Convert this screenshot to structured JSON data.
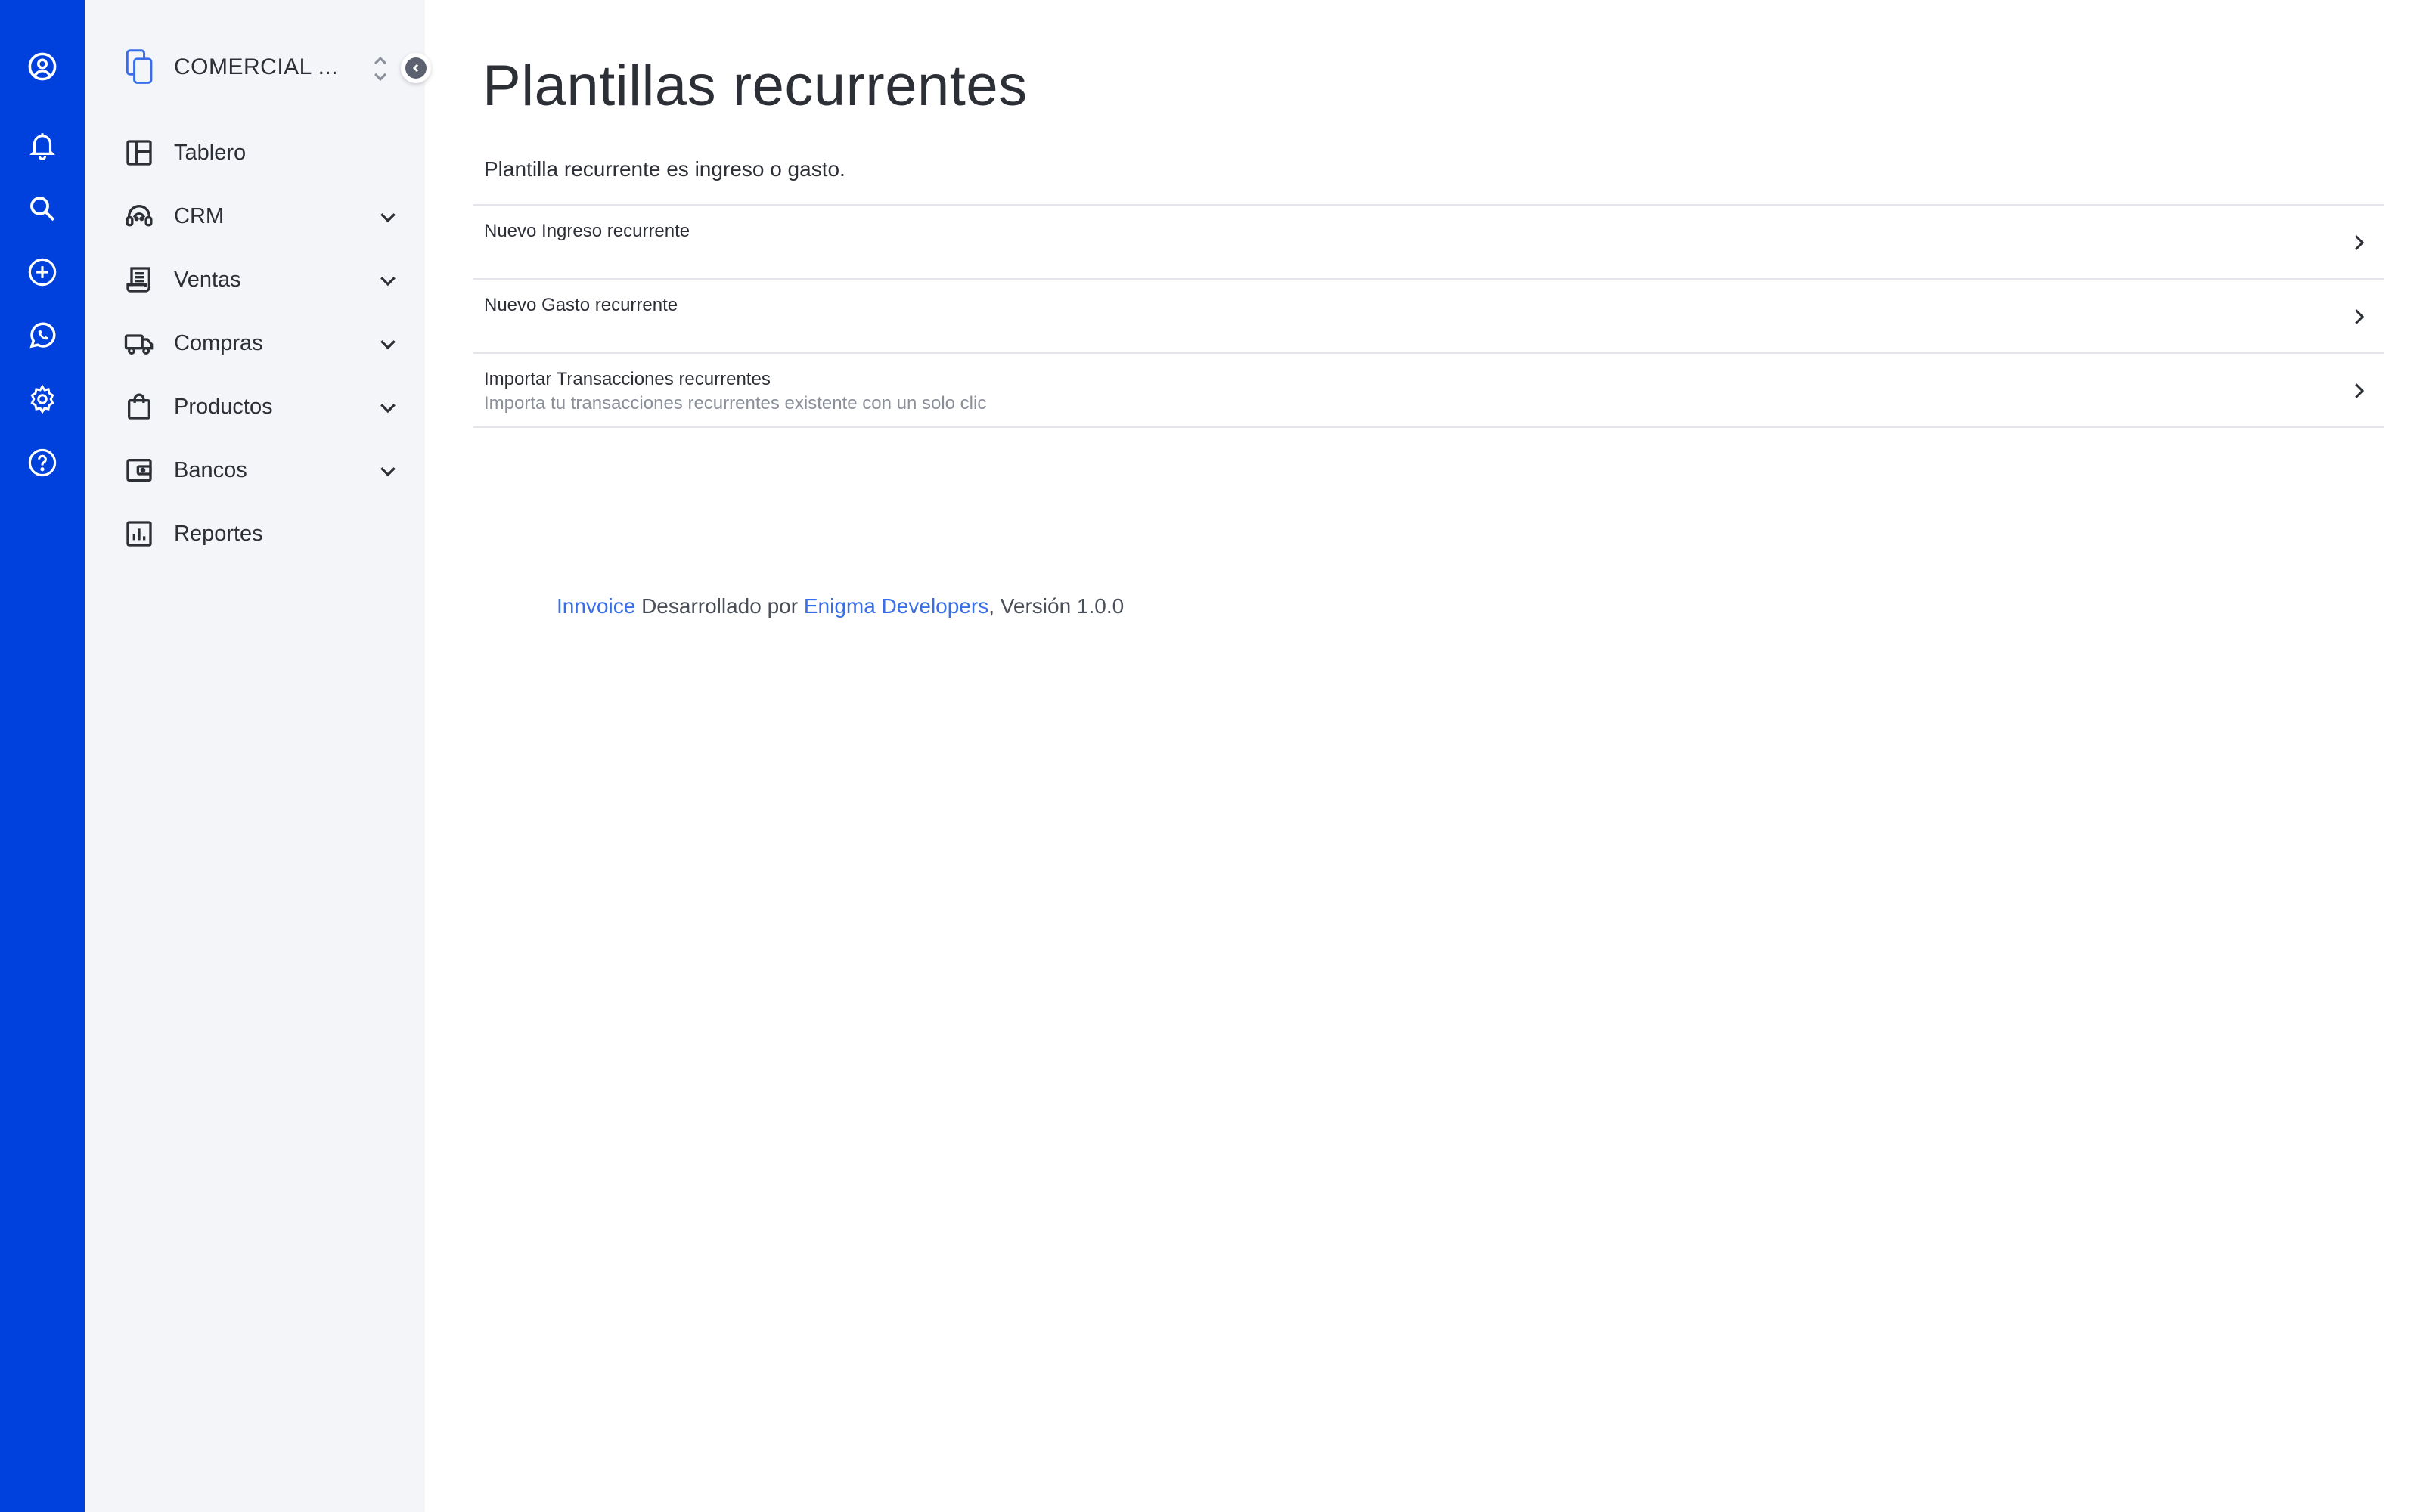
{
  "colors": {
    "rail": "#0040dd",
    "sidebar": "#f3f5f9",
    "link": "#3a6ee8",
    "text": "#2d2f36",
    "muted": "#8a8f99"
  },
  "rail": {
    "items": [
      {
        "icon": "user-circle-icon"
      },
      {
        "icon": "bell-icon"
      },
      {
        "icon": "search-icon"
      },
      {
        "icon": "plus-circle-icon"
      },
      {
        "icon": "whatsapp-icon"
      },
      {
        "icon": "gear-icon"
      },
      {
        "icon": "help-circle-icon"
      }
    ]
  },
  "sidebar": {
    "company_name": "COMERCIAL ...",
    "items": [
      {
        "label": "Tablero",
        "icon": "dashboard-icon",
        "expandable": false
      },
      {
        "label": "CRM",
        "icon": "headset-icon",
        "expandable": true
      },
      {
        "label": "Ventas",
        "icon": "receipt-icon",
        "expandable": true
      },
      {
        "label": "Compras",
        "icon": "truck-icon",
        "expandable": true
      },
      {
        "label": "Productos",
        "icon": "shopping-bag-icon",
        "expandable": true
      },
      {
        "label": "Bancos",
        "icon": "wallet-icon",
        "expandable": true
      },
      {
        "label": "Reportes",
        "icon": "bar-chart-icon",
        "expandable": false
      }
    ]
  },
  "main": {
    "title": "Plantillas recurrentes",
    "description": "Plantilla recurrente es ingreso o gasto.",
    "options": [
      {
        "title": "Nuevo Ingreso recurrente",
        "subtitle": ""
      },
      {
        "title": "Nuevo Gasto recurrente",
        "subtitle": ""
      },
      {
        "title": "Importar Transacciones recurrentes",
        "subtitle": "Importa tu transacciones recurrentes existente con un solo clic"
      }
    ]
  },
  "footer": {
    "app_link": "Innvoice",
    "developed_by": " Desarrollado por ",
    "dev_link": "Enigma Developers",
    "version": ", Versión 1.0.0"
  }
}
